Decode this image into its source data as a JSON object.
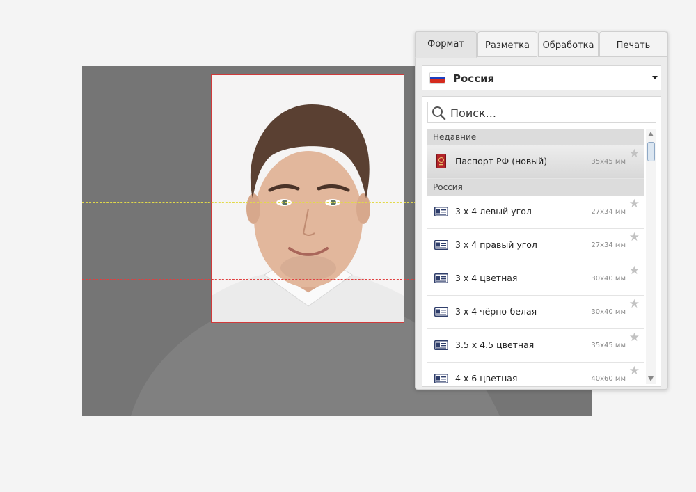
{
  "tabs": [
    {
      "label": "Формат",
      "active": true
    },
    {
      "label": "Разметка",
      "active": false
    },
    {
      "label": "Обработка",
      "active": false
    },
    {
      "label": "Печать",
      "active": false
    }
  ],
  "country": {
    "label": "Россия",
    "flag_colors": [
      "#ffffff",
      "#1c3fbf",
      "#d52b1e"
    ]
  },
  "search": {
    "placeholder": "Поиск..."
  },
  "sections": {
    "recent": "Недавние",
    "country": "Россия"
  },
  "recent_items": [
    {
      "label": "Паспорт РФ (новый)",
      "size": "35x45 мм",
      "icon": "passport-icon",
      "selected": true
    }
  ],
  "country_items": [
    {
      "label": "3 x 4 левый угол",
      "size": "27x34 мм",
      "icon": "id-card-icon"
    },
    {
      "label": "3 x 4 правый угол",
      "size": "27x34 мм",
      "icon": "id-card-icon"
    },
    {
      "label": "3 x 4 цветная",
      "size": "30x40 мм",
      "icon": "id-card-icon"
    },
    {
      "label": "3 x 4 чёрно-белая",
      "size": "30x40 мм",
      "icon": "id-card-icon"
    },
    {
      "label": "3.5 x 4.5 цветная",
      "size": "35x45 мм",
      "icon": "id-card-icon"
    },
    {
      "label": "4 x 6 цветная",
      "size": "40x60 мм",
      "icon": "id-card-icon"
    }
  ],
  "colors": {
    "guide_red": "#e04040",
    "guide_yellow": "#e2d94a",
    "canvas_bg": "#757575"
  }
}
